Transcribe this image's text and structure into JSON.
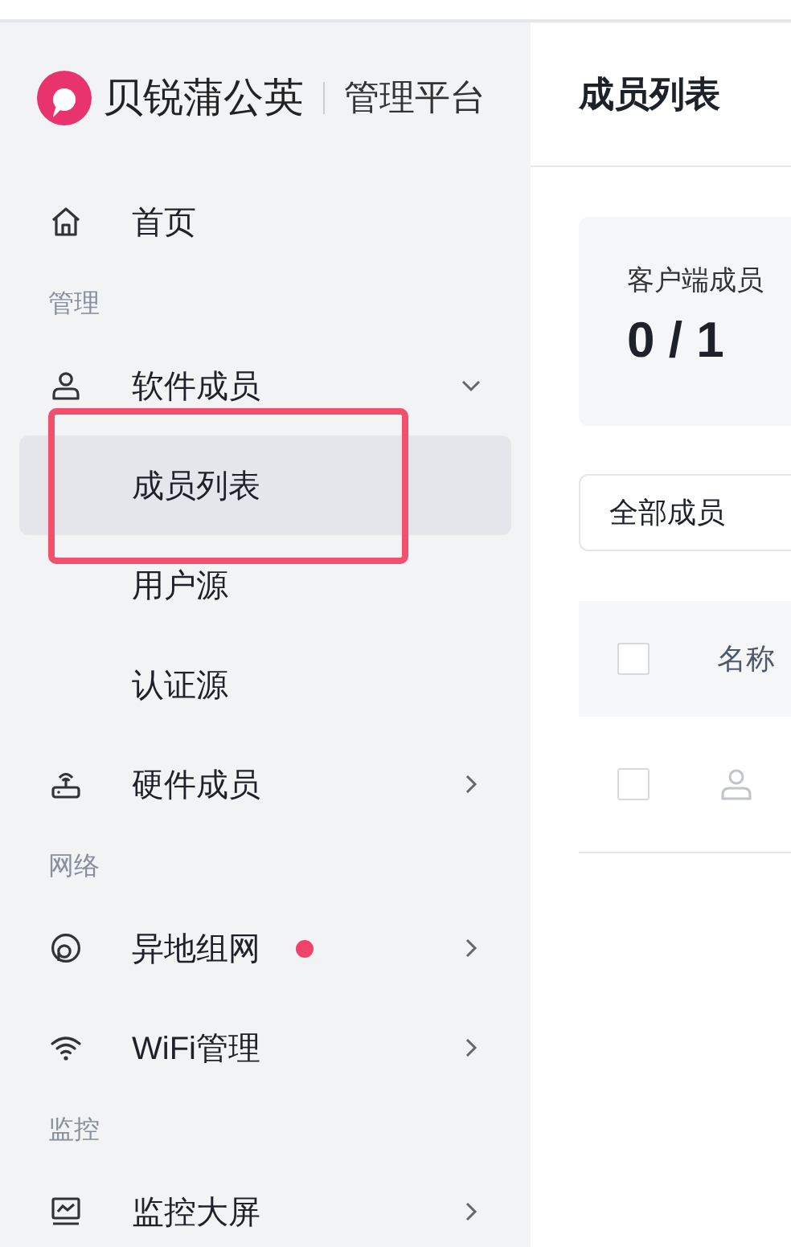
{
  "sidebar": {
    "brand": {
      "name": "贝锐蒲公英",
      "product": "管理平台"
    },
    "nav": [
      {
        "kind": "item",
        "label": "首页",
        "selected": false
      },
      {
        "kind": "section",
        "label": "管理"
      },
      {
        "kind": "item",
        "label": "软件成员",
        "selected": false,
        "expanded": true,
        "children": [
          {
            "label": "成员列表",
            "selected": true,
            "highlighted": true
          },
          {
            "label": "用户源",
            "selected": false,
            "highlighted": false
          },
          {
            "label": "认证源",
            "selected": false,
            "highlighted": false
          }
        ]
      },
      {
        "kind": "item",
        "label": "硬件成员",
        "selected": false,
        "expanded": false
      },
      {
        "kind": "section",
        "label": "网络"
      },
      {
        "kind": "item",
        "label": "异地组网",
        "selected": false,
        "expanded": false,
        "color": "#f0436a"
      },
      {
        "kind": "item",
        "label": "WiFi管理",
        "selected": false,
        "expanded": false
      },
      {
        "kind": "section",
        "label": "监控"
      },
      {
        "kind": "item",
        "label": "监控大屏",
        "selected": false,
        "expanded": false
      }
    ]
  },
  "main": {
    "title": "成员列表",
    "stat_card": {
      "label": "客户端成员",
      "value": "0 / 1"
    },
    "filter": {
      "value": "全部成员"
    },
    "table": {
      "columns": [
        {
          "label": "名称"
        }
      ],
      "header_checked": false,
      "rows": [
        {
          "checked": false,
          "avatar": true
        }
      ]
    }
  }
}
